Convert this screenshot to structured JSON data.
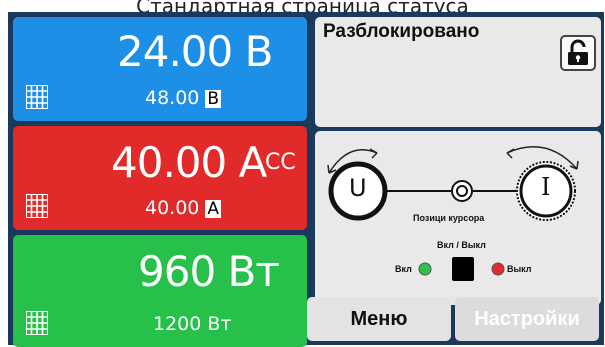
{
  "caption": "Стандартная страница статуса",
  "voltage": {
    "actual": "24.00 В",
    "set_value": "48.00",
    "set_unit": "В"
  },
  "current": {
    "actual": "40.00 А",
    "mode": "CC",
    "set_value": "40.00",
    "set_unit": "А"
  },
  "power": {
    "actual": "960 Вт",
    "set_value": "1200",
    "set_unit": "Вт"
  },
  "status": {
    "lock_text": "Разблокировано"
  },
  "cursor": {
    "left_knob": "U",
    "right_knob": "I",
    "cursor_label": "Позици курсора",
    "toggle_title": "Вкл / Выкл",
    "on_label": "Вкл",
    "off_label": "Выкл"
  },
  "buttons": {
    "menu": "Меню",
    "settings": "Настройки"
  },
  "colors": {
    "frame": "#1b3a5b",
    "voltage": "#1e8fe6",
    "current": "#e22a2a",
    "power": "#27c04a",
    "on_led": "#2ec24a",
    "off_led": "#e22a2a"
  }
}
